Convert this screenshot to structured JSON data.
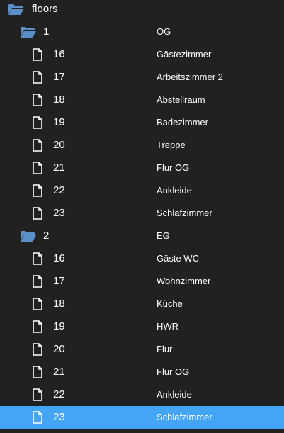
{
  "root": {
    "label": "floors",
    "icon": "folder-open-icon"
  },
  "groups": [
    {
      "key": "1",
      "value": "OG",
      "icon": "folder-open-icon",
      "items": [
        {
          "key": "16",
          "value": "Gästezimmer"
        },
        {
          "key": "17",
          "value": "Arbeitszimmer 2"
        },
        {
          "key": "18",
          "value": "Abstellraum"
        },
        {
          "key": "19",
          "value": "Badezimmer"
        },
        {
          "key": "20",
          "value": "Treppe"
        },
        {
          "key": "21",
          "value": "Flur OG"
        },
        {
          "key": "22",
          "value": "Ankleide"
        },
        {
          "key": "23",
          "value": "Schlafzimmer"
        }
      ]
    },
    {
      "key": "2",
      "value": "EG",
      "icon": "folder-open-icon",
      "items": [
        {
          "key": "16",
          "value": "Gäste WC"
        },
        {
          "key": "17",
          "value": "Wohnzimmer"
        },
        {
          "key": "18",
          "value": "Küche"
        },
        {
          "key": "19",
          "value": "HWR"
        },
        {
          "key": "20",
          "value": "Flur"
        },
        {
          "key": "21",
          "value": "Flur OG"
        },
        {
          "key": "22",
          "value": "Ankleide"
        },
        {
          "key": "23",
          "value": "Schlafzimmer",
          "selected": true
        }
      ]
    }
  ],
  "colors": {
    "background": "#212121",
    "selection": "#42a5f5",
    "folder": "#5b8fc7",
    "text": "#ffffff"
  }
}
